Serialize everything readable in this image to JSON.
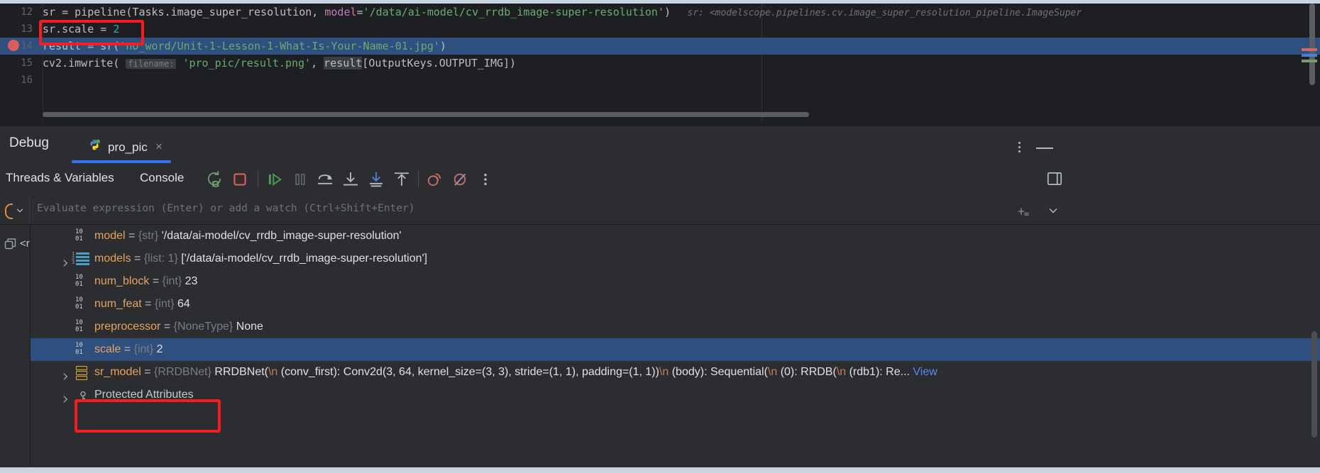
{
  "editor": {
    "lines": [
      {
        "number": "12",
        "tokens": [
          {
            "t": "sr = pipeline(Tasks.image_super_resolution, ",
            "c": "c-def"
          },
          {
            "t": "model",
            "c": "c-kwarg"
          },
          {
            "t": "=",
            "c": "c-def"
          },
          {
            "t": "'/data/ai-model/cv_rrdb_image-super-resolution'",
            "c": "c-str"
          },
          {
            "t": ")",
            "c": "c-def"
          }
        ],
        "inlay": "sr: <modelscope.pipelines.cv.image_super_resolution_pipeline.ImageSuper",
        "selected": false,
        "breakpoint": false
      },
      {
        "number": "13",
        "tokens": [
          {
            "t": "sr.scale = ",
            "c": "c-def"
          },
          {
            "t": "2",
            "c": "c-num"
          }
        ],
        "inlay": "",
        "selected": false,
        "breakpoint": false
      },
      {
        "number": "14",
        "tokens": [
          {
            "t": "result = sr(",
            "c": "c-def"
          },
          {
            "t": "'no_word/Unit-1-Lesson-1-What-Is-Your-Name-01.jpg'",
            "c": "c-str"
          },
          {
            "t": ")",
            "c": "c-def"
          }
        ],
        "inlay": "",
        "selected": true,
        "breakpoint": true
      },
      {
        "number": "15",
        "tokens": [
          {
            "t": "cv2.imwrite( ",
            "c": "c-def"
          },
          {
            "t": "filename:",
            "c": "c-param"
          },
          {
            "t": " ",
            "c": "c-def"
          },
          {
            "t": "'pro_pic/result.png'",
            "c": "c-str"
          },
          {
            "t": ", ",
            "c": "c-def"
          },
          {
            "t": "result",
            "c": "c-hl"
          },
          {
            "t": "[OutputKeys.OUTPUT_IMG])",
            "c": "c-def"
          }
        ],
        "inlay": "",
        "selected": false,
        "breakpoint": false
      },
      {
        "number": "16",
        "tokens": [],
        "inlay": "",
        "selected": false,
        "breakpoint": false
      }
    ]
  },
  "debug": {
    "title": "Debug",
    "tab_label": "pro_pic",
    "tab_close_label": "×",
    "toolbar_tabs": [
      {
        "label": "Threads & Variables",
        "active": true
      },
      {
        "label": "Console",
        "active": false
      }
    ],
    "buttons": [
      {
        "name": "rerun-button",
        "title": "Rerun"
      },
      {
        "name": "stop-button",
        "title": "Stop"
      },
      {
        "name": "resume-button",
        "title": "Resume Program"
      },
      {
        "name": "pause-button",
        "title": "Pause Program"
      },
      {
        "name": "step-over-button",
        "title": "Step Over"
      },
      {
        "name": "step-into-button",
        "title": "Step Into"
      },
      {
        "name": "force-step-into-button",
        "title": "Force Step Into"
      },
      {
        "name": "step-out-button",
        "title": "Step Out"
      },
      {
        "name": "view-breakpoints-button",
        "title": "View Breakpoints"
      },
      {
        "name": "mute-breakpoints-button",
        "title": "Mute Breakpoints"
      },
      {
        "name": "more-options-button",
        "title": "More"
      }
    ],
    "evaluate_placeholder": "Evaluate expression (Enter) or add a watch (Ctrl+Shift+Enter)",
    "frame_label": "<r",
    "variables": [
      {
        "icon": "binary-icon",
        "expandable": false,
        "name": "model",
        "type": "{str}",
        "value": "'/data/ai-model/cv_rrdb_image-super-resolution'",
        "selected": false
      },
      {
        "icon": "list-icon",
        "expandable": true,
        "name": "models",
        "type": "{list: 1}",
        "value": "['/data/ai-model/cv_rrdb_image-super-resolution']",
        "selected": false
      },
      {
        "icon": "binary-icon",
        "expandable": false,
        "name": "num_block",
        "type": "{int}",
        "value": "23",
        "selected": false
      },
      {
        "icon": "binary-icon",
        "expandable": false,
        "name": "num_feat",
        "type": "{int}",
        "value": "64",
        "selected": false
      },
      {
        "icon": "binary-icon",
        "expandable": false,
        "name": "preprocessor",
        "type": "{NoneType}",
        "value": "None",
        "selected": false
      },
      {
        "icon": "binary-icon",
        "expandable": false,
        "name": "scale",
        "type": "{int}",
        "value": "2",
        "selected": true
      },
      {
        "icon": "object-icon",
        "expandable": true,
        "name": "sr_model",
        "type": "{RRDBNet}",
        "value": "RRDBNet(\\n  (conv_first): Conv2d(3, 64, kernel_size=(3, 3), stride=(1, 1), padding=(1, 1))\\n  (body): Sequential(\\n    (0): RRDB(\\n      (rdb1): Re...",
        "link": "View",
        "selected": false
      },
      {
        "icon": "key-icon",
        "expandable": true,
        "name": "Protected Attributes",
        "type": "",
        "value": "",
        "group": true,
        "selected": false
      }
    ]
  },
  "annotations": [
    {
      "name": "code-scale-highlight",
      "target": "sr.scale = 2"
    },
    {
      "name": "variable-scale-highlight",
      "target": "scale = {int} 2"
    }
  ],
  "colors": {
    "accent": "#3574f0",
    "selection": "#2f4f7f",
    "annotation": "#f51d21",
    "string": "#6aab73",
    "number": "#2aacb8",
    "varname": "#e8a35f"
  }
}
